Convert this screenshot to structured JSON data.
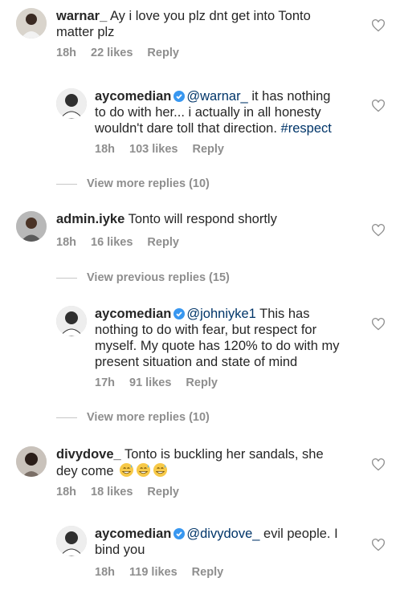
{
  "comments": [
    {
      "username": "warnar_",
      "text": " Ay i love you plz dnt get into Tonto",
      "text2": "matter plz",
      "time": "18h",
      "likes": "22 likes",
      "reply": "Reply"
    },
    {
      "username": "aycomedian",
      "mention": "@warnar_",
      "text": "  it has nothing",
      "text2": "to do with her... i actually in all honesty",
      "text3": "wouldn't dare toll that direction. ",
      "hashtag": "#respect",
      "time": "18h",
      "likes": "103 likes",
      "reply": "Reply"
    },
    {
      "username": "admin.iyke",
      "text": " Tonto will respond shortly",
      "time": "18h",
      "likes": "16 likes",
      "reply": "Reply"
    },
    {
      "username": "aycomedian",
      "mention": "@johniyke1",
      "text": " This has",
      "text2": "nothing to do with fear, but respect for",
      "text3": "myself.  My quote has 120% to do with my",
      "text4": "present situation and state of mind",
      "time": "17h",
      "likes": "91 likes",
      "reply": "Reply"
    },
    {
      "username": "divydove_",
      "text": " Tonto is buckling her sandals, she",
      "text2": "dey come",
      "time": "18h",
      "likes": "18 likes",
      "reply": "Reply"
    },
    {
      "username": "aycomedian",
      "mention": "@divydove_",
      "text": " evil people. I",
      "text2": "bind you",
      "time": "18h",
      "likes": "119 likes",
      "reply": "Reply"
    }
  ],
  "toggles": {
    "more1": "View more replies (10)",
    "prev": "View previous replies (15)",
    "more2": "View more replies (10)"
  },
  "colors": {
    "link": "#003569",
    "meta": "#8e8e8e",
    "verified": "#3897f0"
  },
  "icons": [
    "heart-outline-icon",
    "verified-badge-icon",
    "grimacing-sweat-emoji"
  ]
}
